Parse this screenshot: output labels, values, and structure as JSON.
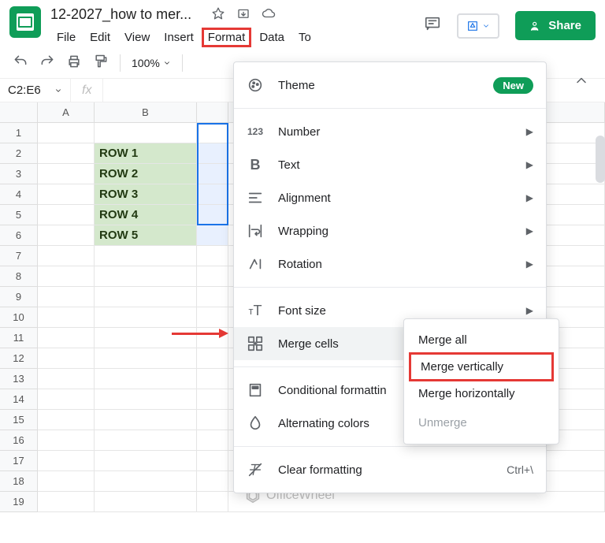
{
  "header": {
    "doc_title": "12-2027_how to mer...",
    "menu": {
      "file": "File",
      "edit": "Edit",
      "view": "View",
      "insert": "Insert",
      "format": "Format",
      "data": "Data",
      "tools": "To"
    },
    "share": "Share"
  },
  "toolbar": {
    "zoom": "100%"
  },
  "namebox": "C2:E6",
  "column_headers": [
    "A",
    "B"
  ],
  "rows": [
    {
      "n": "1",
      "b": ""
    },
    {
      "n": "2",
      "b": "ROW 1"
    },
    {
      "n": "3",
      "b": "ROW 2"
    },
    {
      "n": "4",
      "b": "ROW 3"
    },
    {
      "n": "5",
      "b": "ROW 4"
    },
    {
      "n": "6",
      "b": "ROW 5"
    },
    {
      "n": "7",
      "b": ""
    },
    {
      "n": "8",
      "b": ""
    },
    {
      "n": "9",
      "b": ""
    },
    {
      "n": "10",
      "b": ""
    },
    {
      "n": "11",
      "b": ""
    },
    {
      "n": "12",
      "b": ""
    },
    {
      "n": "13",
      "b": ""
    },
    {
      "n": "14",
      "b": ""
    },
    {
      "n": "15",
      "b": ""
    },
    {
      "n": "16",
      "b": ""
    },
    {
      "n": "17",
      "b": ""
    },
    {
      "n": "18",
      "b": ""
    },
    {
      "n": "19",
      "b": ""
    }
  ],
  "format_menu": {
    "theme": "Theme",
    "theme_badge": "New",
    "number": "Number",
    "text": "Text",
    "alignment": "Alignment",
    "wrapping": "Wrapping",
    "rotation": "Rotation",
    "font_size": "Font size",
    "merge_cells": "Merge cells",
    "conditional": "Conditional formattin",
    "alternating": "Alternating colors",
    "clear": "Clear formatting",
    "clear_shortcut": "Ctrl+\\"
  },
  "merge_submenu": {
    "all": "Merge all",
    "vertical": "Merge vertically",
    "horizontal": "Merge horizontally",
    "unmerge": "Unmerge"
  },
  "watermark": "OfficeWheel"
}
